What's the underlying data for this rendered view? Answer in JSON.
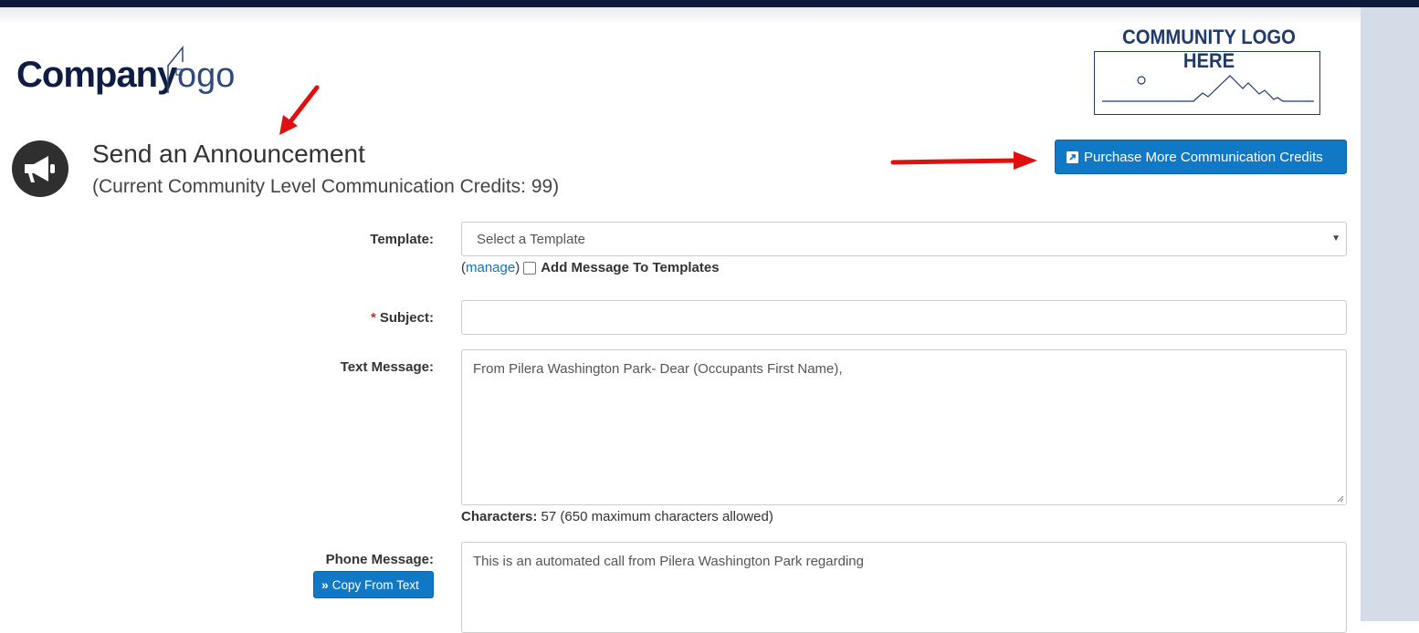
{
  "branding": {
    "company_logo_word1": "Company",
    "company_logo_word2": "ogo",
    "community_logo_title": "COMMUNITY LOGO HERE"
  },
  "header": {
    "title": "Send an Announcement",
    "subtitle": "(Current Community Level Communication Credits: 99)",
    "purchase_button": "Purchase More Communication Credits"
  },
  "form": {
    "template": {
      "label": "Template:",
      "selected": "Select a Template",
      "manage_open": "(",
      "manage_link": "manage",
      "manage_close": ")",
      "add_to_templates": "Add Message To Templates"
    },
    "subject": {
      "required_mark": "*",
      "label": "Subject:",
      "value": ""
    },
    "text_message": {
      "label": "Text Message:",
      "value": "From Pilera Washington Park- Dear (Occupants First Name),",
      "characters_label": "Characters:",
      "characters_info": " 57 (650 maximum characters allowed)"
    },
    "phone_message": {
      "label": "Phone Message:",
      "copy_button": "Copy From Text",
      "value": "This is an automated call from Pilera Washington Park regarding"
    }
  },
  "colors": {
    "primary_button": "#1178c5",
    "navy": "#0f1d44",
    "required": "#c9302c",
    "annotation_arrow": "#e01010"
  },
  "icons": [
    "megaphone-icon",
    "external-link-icon",
    "double-chevron-right-icon",
    "dropdown-caret-icon",
    "house-icon"
  ]
}
